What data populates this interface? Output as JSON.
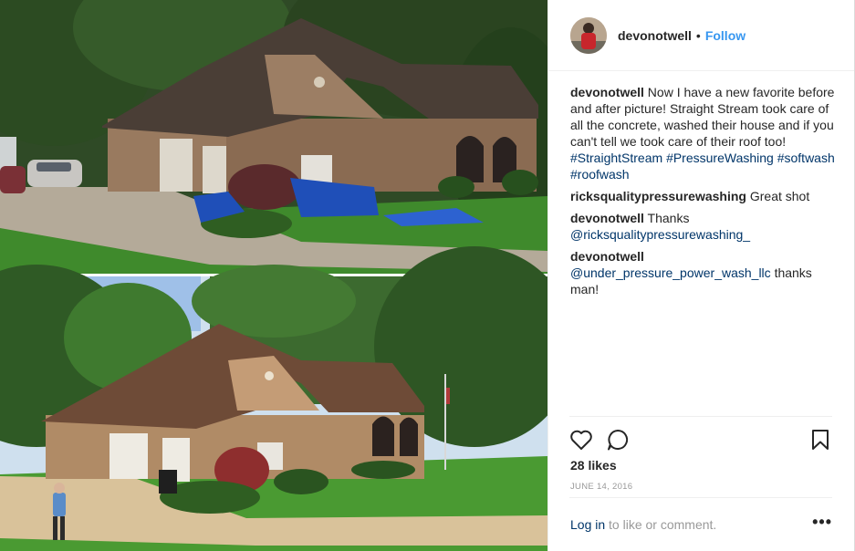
{
  "post": {
    "username": "devonotwell",
    "separator": "•",
    "follow_label": "Follow"
  },
  "comments": [
    {
      "user": "devonotwell",
      "text": "Now I have a new favorite before and after picture! Straight Stream took care of all the concrete, washed their house and if you can't tell we took care of their roof too!",
      "hashtags": [
        "#StraightStream",
        "#PressureWashing",
        "#softwash",
        "#roofwash"
      ]
    },
    {
      "user": "ricksqualitypressurewashing",
      "text": "Great shot"
    },
    {
      "user": "devonotwell",
      "text": "Thanks",
      "mention": "@ricksqualitypressurewashing_"
    },
    {
      "user": "devonotwell",
      "mention": "@under_pressure_power_wash_llc",
      "text": "thanks man!"
    }
  ],
  "actions": {
    "like_icon": "heart-outline-icon",
    "comment_icon": "speech-bubble-icon",
    "save_icon": "bookmark-outline-icon"
  },
  "likes_text": "28 likes",
  "date_text": "JUNE 14, 2016",
  "footer": {
    "login_link": "Log in",
    "login_rest": "to like or comment.",
    "more_label": "•••"
  },
  "colors": {
    "link_blue": "#3897f0",
    "hashtag_navy": "#003569",
    "text_dark": "#262626",
    "muted_gray": "#999999"
  }
}
